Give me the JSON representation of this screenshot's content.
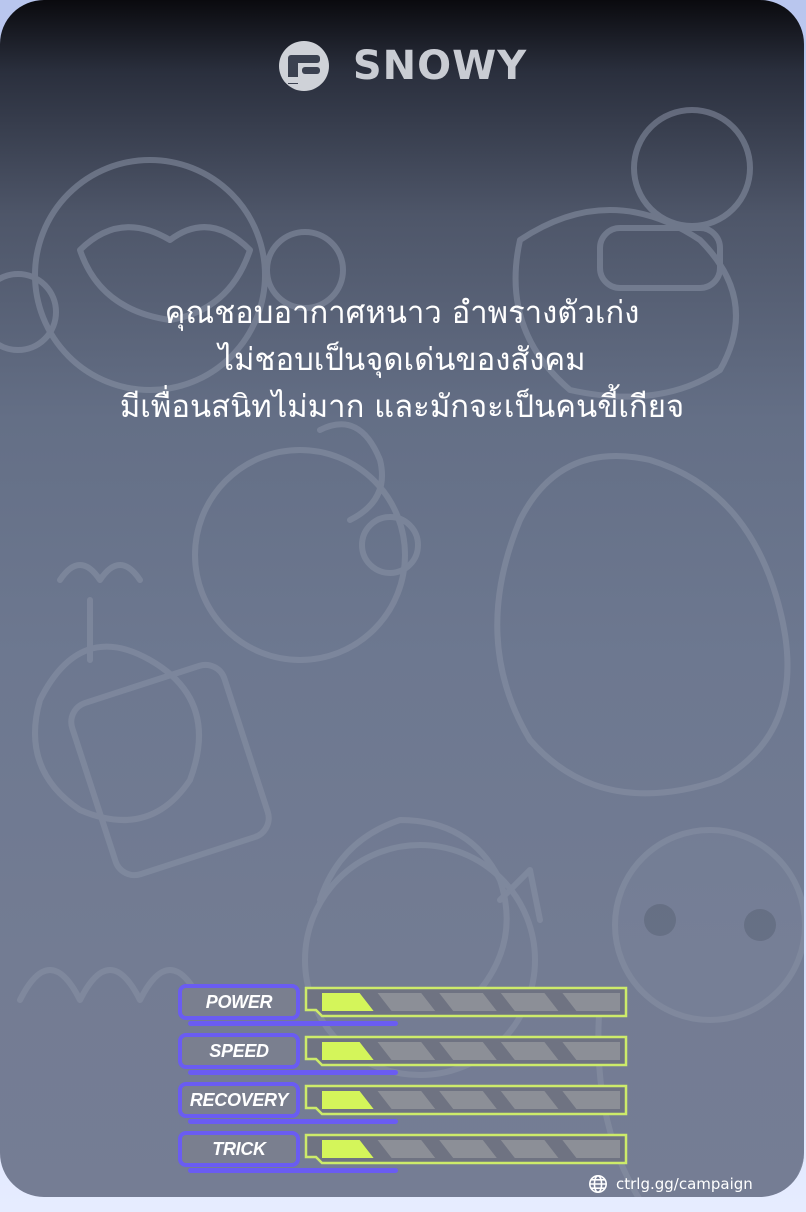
{
  "brand": {
    "name": "SNOWY",
    "logo_icon": "f-monogram-icon"
  },
  "quote": {
    "lines": [
      "คุณชอบอากาศหนาว อำพรางตัวเก่ง",
      "ไม่ชอบเป็นจุดเด่นของสังคม",
      "มีเพื่อนสนิทไม่มาก และมักจะเป็นคนขี้เกียจ"
    ]
  },
  "stats": [
    {
      "label": "POWER",
      "level": 1,
      "max": 5
    },
    {
      "label": "SPEED",
      "level": 1,
      "max": 5
    },
    {
      "label": "RECOVERY",
      "level": 1,
      "max": 5
    },
    {
      "label": "TRICK",
      "level": 1,
      "max": 5
    }
  ],
  "footer": {
    "link_text": "ctrlg.gg/campaign",
    "icon": "globe-icon"
  },
  "colors": {
    "accent_purple": "#6a5cf2",
    "bar_fill_lime": "#d4f55a",
    "bar_empty": "#8c8f97",
    "bar_border": "#cdeb6a"
  }
}
